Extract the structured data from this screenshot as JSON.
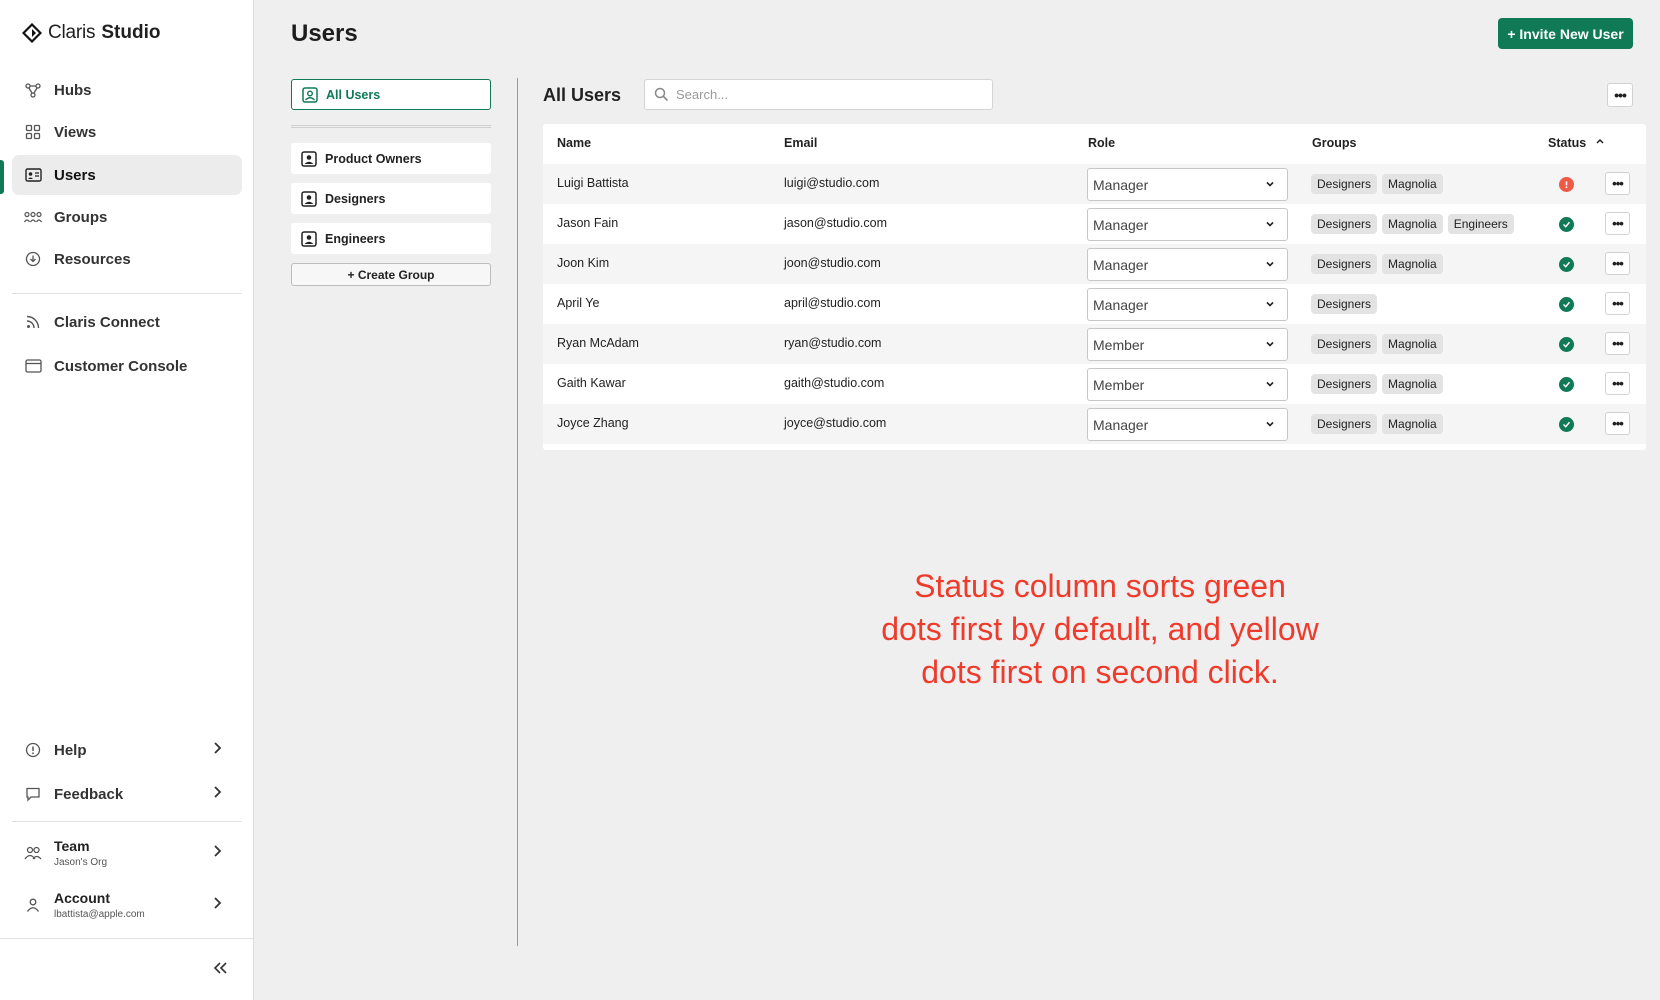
{
  "brand": {
    "name": "Claris",
    "product": "Studio"
  },
  "sidebar": {
    "nav": [
      {
        "label": "Hubs",
        "icon": "hubs-icon"
      },
      {
        "label": "Views",
        "icon": "views-icon"
      },
      {
        "label": "Users",
        "icon": "users-icon",
        "active": true
      },
      {
        "label": "Groups",
        "icon": "groups-icon"
      },
      {
        "label": "Resources",
        "icon": "resources-icon"
      }
    ],
    "external": [
      {
        "label": "Claris Connect",
        "icon": "connect-icon"
      },
      {
        "label": "Customer Console",
        "icon": "console-icon"
      }
    ],
    "help_label": "Help",
    "feedback_label": "Feedback",
    "team": {
      "title": "Team",
      "subtitle": "Jason's Org"
    },
    "account": {
      "title": "Account",
      "subtitle": "lbattista@apple.com"
    }
  },
  "header": {
    "title": "Users",
    "invite_label": "+ Invite New User"
  },
  "groups_panel": {
    "all_users": "All Users",
    "groups": [
      "Product Owners",
      "Designers",
      "Engineers"
    ],
    "create_label": "+ Create Group"
  },
  "list": {
    "title": "All Users",
    "search_placeholder": "Search...",
    "columns": {
      "name": "Name",
      "email": "Email",
      "role": "Role",
      "groups": "Groups",
      "status": "Status"
    },
    "rows": [
      {
        "name": "Luigi Battista",
        "email": "luigi@studio.com",
        "role": "Manager",
        "groups": [
          "Designers",
          "Magnolia"
        ],
        "status": "warning"
      },
      {
        "name": "Jason Fain",
        "email": "jason@studio.com",
        "role": "Manager",
        "groups": [
          "Designers",
          "Magnolia",
          "Engineers"
        ],
        "status": "ok"
      },
      {
        "name": "Joon Kim",
        "email": "joon@studio.com",
        "role": "Manager",
        "groups": [
          "Designers",
          "Magnolia"
        ],
        "status": "ok"
      },
      {
        "name": "April Ye",
        "email": "april@studio.com",
        "role": "Manager",
        "groups": [
          "Designers"
        ],
        "status": "ok"
      },
      {
        "name": "Ryan McAdam",
        "email": "ryan@studio.com",
        "role": "Member",
        "groups": [
          "Designers",
          "Magnolia"
        ],
        "status": "ok"
      },
      {
        "name": "Gaith Kawar",
        "email": "gaith@studio.com",
        "role": "Member",
        "groups": [
          "Designers",
          "Magnolia"
        ],
        "status": "ok"
      },
      {
        "name": "Joyce Zhang",
        "email": "joyce@studio.com",
        "role": "Manager",
        "groups": [
          "Designers",
          "Magnolia"
        ],
        "status": "ok"
      }
    ]
  },
  "annotation": "Status column sorts green dots first by default, and yellow dots first on second click.",
  "colors": {
    "accent": "#0f7a55",
    "status_ok": "#0f7a55",
    "status_warning": "#ee5a45",
    "annotation": "#ee3b2c"
  }
}
